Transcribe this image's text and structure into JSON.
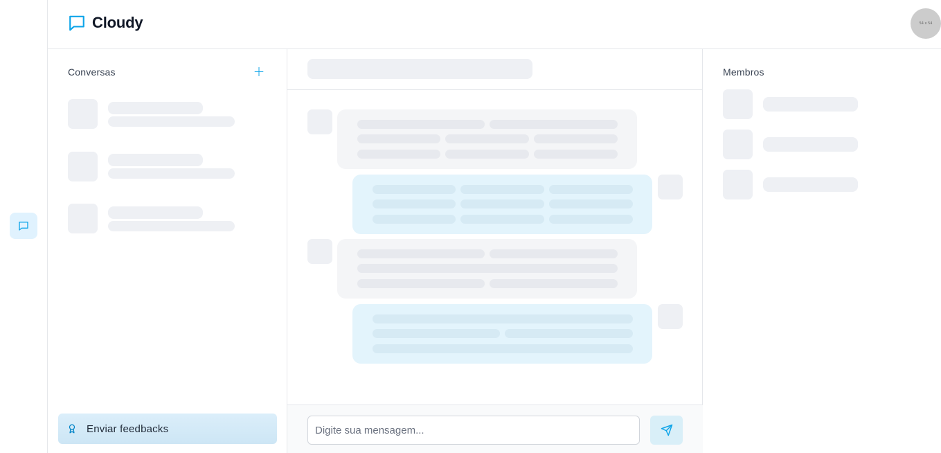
{
  "app": {
    "name": "Cloudy",
    "accent": "#0ea5e9"
  },
  "header": {
    "avatar_text": "54 x 54"
  },
  "sidebar": {
    "active_icon": "chat-icon"
  },
  "conversations": {
    "title": "Conversas",
    "add_icon": "plus-icon",
    "feedback_label": "Enviar feedbacks",
    "feedback_icon": "award-icon"
  },
  "members": {
    "title": "Membros"
  },
  "composer": {
    "placeholder": "Digite sua mensagem...",
    "send_icon": "send-icon"
  }
}
